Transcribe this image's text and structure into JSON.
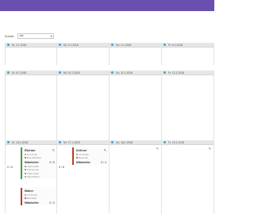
{
  "filter": {
    "label": "Kunde",
    "value": "n/a"
  },
  "row1": [
    {
      "date": "Di. 2.1.2018"
    },
    {
      "date": "Mi. 3.1.2018"
    },
    {
      "date": "Do. 4.1.2018"
    },
    {
      "date": "Fr. 5.1.2018"
    }
  ],
  "row2": [
    {
      "date": "Di. 9.1.2018"
    },
    {
      "date": "Mi. 10.1.2018"
    },
    {
      "date": "Do. 11.1.2018"
    },
    {
      "date": "Fr. 12.1.2018"
    }
  ],
  "row3": [
    {
      "date": "Di. 16.1.2018",
      "count": "0 / 8"
    },
    {
      "date": "Mi. 17.1.2018",
      "count": "0 / 8"
    },
    {
      "date": "Do. 18.1.2018"
    },
    {
      "date": "Fr. 19.1.2018"
    }
  ],
  "shifts": {
    "koch": {
      "title": "Richter",
      "time": "14:10 Uhr",
      "location": "Bad Oldesloe",
      "staff_label": "Mitarbeiter",
      "staff_count": "3 / 5",
      "names": [
        "Veith Noah",
        "Zeeng Lisa",
        "Zeliss Sara",
        "Mani Wilma"
      ]
    },
    "kellner": {
      "title": "Kellner",
      "time": "12:45 Uhr",
      "location": "Beyreuth",
      "staff_label": "Mitarbeiter",
      "staff_count": "0 / 4"
    },
    "baker": {
      "title": "Baker",
      "time": "17:30 Uhr",
      "location": "Eichwald",
      "staff_label": "Mitarbeiter",
      "staff_count": "0 / 4"
    }
  },
  "icons": {
    "edit": "pencil-icon",
    "pin": "location-dot-icon"
  },
  "colors": {
    "header_bar": "#6b4fb0",
    "pin": "#3aa6d8",
    "green": "#4a9a44",
    "red": "#c0392b"
  }
}
